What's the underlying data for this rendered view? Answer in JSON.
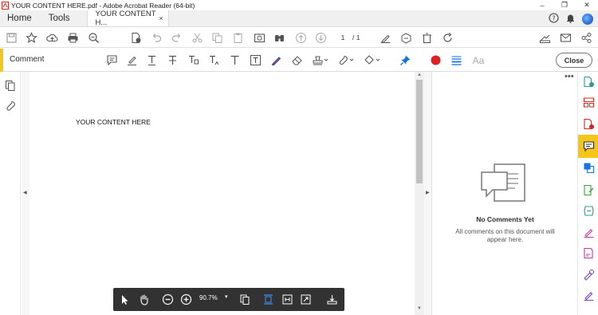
{
  "window": {
    "title": "YOUR CONTENT HERE.pdf - Adobe Acrobat Reader (64-bit)",
    "controls": [
      "minimize",
      "restore",
      "close"
    ]
  },
  "tabs": {
    "home": "Home",
    "tools": "Tools",
    "document": "YOUR CONTENT H...",
    "close_glyph": "×"
  },
  "toolbar": {
    "page_current": "1",
    "page_total": "/ 1",
    "icons": [
      "save-icon",
      "bookmark-star-icon",
      "upload-icon",
      "print-icon",
      "zoom-search-icon",
      "protect-doc-icon",
      "undo-icon",
      "redo-icon",
      "cut-icon",
      "copy-icon",
      "paste-icon",
      "snapshot-icon",
      "find-binoculars-icon",
      "page-up-icon",
      "page-down-icon",
      "sign-pen-icon",
      "fill-sign-icon",
      "delete-icon",
      "rotate-icon",
      "sign-tray-icon",
      "mail-icon",
      "share-link-icon"
    ]
  },
  "comment_bar": {
    "label": "Comment",
    "close": "Close",
    "text_size_glyph": "Aa"
  },
  "document": {
    "content_text": "YOUR CONTENT HERE"
  },
  "floating_bar": {
    "zoom": "90.7%",
    "caret": "▾"
  },
  "comments_panel": {
    "more": "•••",
    "title": "No Comments Yet",
    "description": "All comments on this document will appear here."
  },
  "colors": {
    "accent_yellow": "#f5c518",
    "record_red": "#e02020",
    "pin_blue": "#1473e6",
    "float_bar_bg": "#323232"
  }
}
